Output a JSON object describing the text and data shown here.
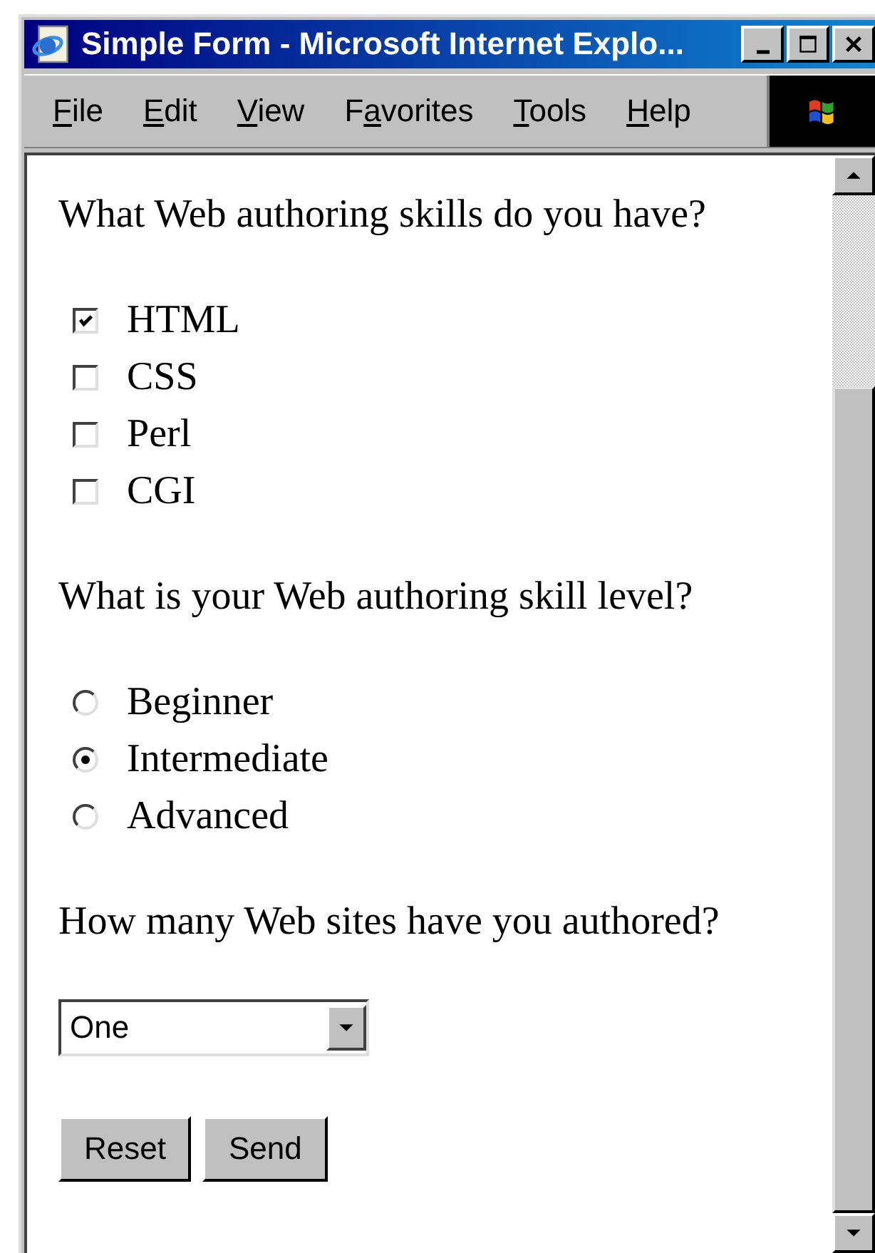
{
  "window": {
    "title": "Simple Form - Microsoft Internet Explo..."
  },
  "menu": [
    {
      "key": "F",
      "post": "ile"
    },
    {
      "key": "E",
      "post": "dit"
    },
    {
      "key": "V",
      "post": "iew"
    },
    {
      "pre": "F",
      "key": "a",
      "post": "vorites"
    },
    {
      "key": "T",
      "post": "ools"
    },
    {
      "key": "H",
      "post": "elp"
    }
  ],
  "form": [
    {
      "kind": "question",
      "text": "What Web authoring skills do you have?"
    },
    {
      "kind": "checkboxes",
      "items": [
        {
          "label": "HTML",
          "checked": true
        },
        {
          "label": "CSS",
          "checked": false
        },
        {
          "label": "Perl",
          "checked": false
        },
        {
          "label": "CGI",
          "checked": false
        }
      ]
    },
    {
      "kind": "question",
      "text": "What is your Web authoring skill level?"
    },
    {
      "kind": "radios",
      "items": [
        {
          "label": "Beginner",
          "selected": false
        },
        {
          "label": "Intermediate",
          "selected": true
        },
        {
          "label": "Advanced",
          "selected": false
        }
      ]
    },
    {
      "kind": "question",
      "text": "How many Web sites have you authored?"
    },
    {
      "kind": "select",
      "value": "One"
    },
    {
      "kind": "buttons",
      "items": [
        "Reset",
        "Send"
      ]
    }
  ]
}
